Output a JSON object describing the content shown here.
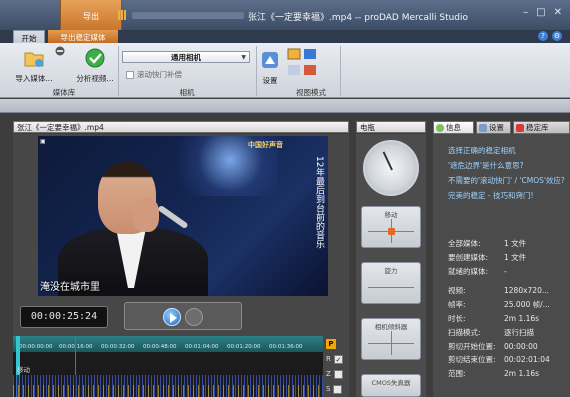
{
  "titlebar": {
    "context_tab": "导出",
    "title": "张江《一定要幸福》.mp4 -- proDAD Mercalli Studio"
  },
  "tabs": {
    "start": "开始",
    "export_stable": "导出稳定媒体"
  },
  "ribbon": {
    "import_label": "导入媒体...",
    "analyze_label": "分析视频...",
    "media_group": "媒体库",
    "camera_select": "通用相机",
    "rolling_shutter": "滚动快门补偿",
    "camera_group": "相机",
    "settings_label": "设置",
    "view_group": "视图模式"
  },
  "video": {
    "panel_title": "张江《一定要幸福》.mp4",
    "osd_logo": "中国好声音",
    "side_text": "12年最后到台前的音乐",
    "subtitle": "淹没在城市里",
    "timecode": "00:00:25:24",
    "ticks": [
      "00:00:00:00",
      "00:00:16:00",
      "00:00:32:00",
      "00:00:48:00",
      "00:01:04:00",
      "00:01:20:00",
      "00:01:36:00"
    ],
    "track_label": "移动"
  },
  "timeline_side": {
    "p": "P",
    "r": "R",
    "z": "Z",
    "s": "S"
  },
  "meters": {
    "panel_title": "电瓶",
    "card1": "移动",
    "card2": "旋力",
    "card3": "相机倾斜器",
    "card4": "CMOS失真器"
  },
  "info": {
    "tab_info": "信息",
    "tab_settings": "设置",
    "tab_stable": "稳定库",
    "links": [
      "选择正确的稳定相机",
      "'遮危边界'是什么意思?",
      "不需要的'滚动快门' / 'CMOS'效应?",
      "完美的稳定 - 技巧和窍门!"
    ],
    "props1": [
      {
        "k": "全部媒体:",
        "v": "1 文件"
      },
      {
        "k": "要创建媒体:",
        "v": "1 文件"
      },
      {
        "k": "就绪的媒体:",
        "v": "-"
      }
    ],
    "props2": [
      {
        "k": "视频:",
        "v": "1280x720..."
      },
      {
        "k": "帧率:",
        "v": "25.000 帧/..."
      },
      {
        "k": "时长:",
        "v": "2m 1.16s"
      },
      {
        "k": "扫描模式:",
        "v": "逐行扫描"
      },
      {
        "k": "剪切开始位置:",
        "v": "00:00:00"
      },
      {
        "k": "剪切结束位置:",
        "v": "00:02:01:04"
      },
      {
        "k": "范围:",
        "v": "2m 1.16s"
      }
    ]
  }
}
